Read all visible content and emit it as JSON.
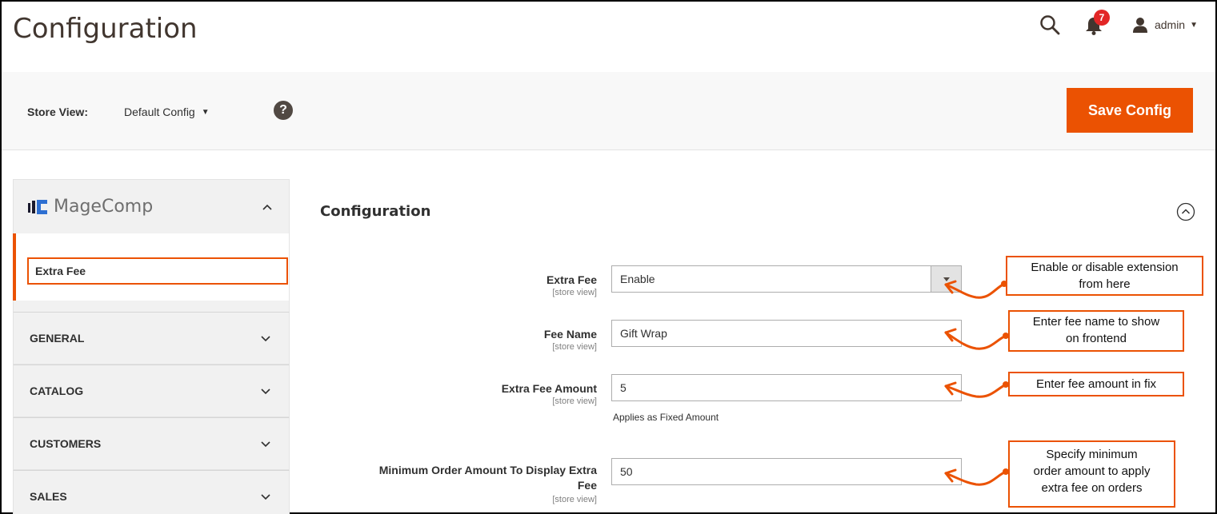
{
  "header": {
    "title": "Configuration",
    "notification_count": "7",
    "user_name": "admin"
  },
  "store_bar": {
    "label": "Store View:",
    "selected": "Default Config",
    "save_label": "Save Config"
  },
  "sidebar": {
    "brand": "MageComp",
    "active_item": "Extra Fee",
    "sections": [
      {
        "label": "GENERAL"
      },
      {
        "label": "CATALOG"
      },
      {
        "label": "CUSTOMERS"
      },
      {
        "label": "SALES"
      }
    ]
  },
  "main": {
    "section_title": "Configuration",
    "fields": [
      {
        "label": "Extra Fee",
        "scope": "[store view]",
        "value": "Enable"
      },
      {
        "label": "Fee Name",
        "scope": "[store view]",
        "value": "Gift Wrap"
      },
      {
        "label": "Extra Fee Amount",
        "scope": "[store view]",
        "value": "5",
        "note": "Applies as Fixed Amount"
      },
      {
        "label_line1": "Minimum Order Amount To Display Extra",
        "label_line2": "Fee",
        "scope": "[store view]",
        "value": "50"
      }
    ]
  },
  "annotations": [
    {
      "line1": "Enable or disable extension",
      "line2": "from here"
    },
    {
      "line1": "Enter fee name to show",
      "line2": "on frontend"
    },
    {
      "line1": "Enter fee amount in fix"
    },
    {
      "line1": "Specify minimum",
      "line2": "order amount to apply",
      "line3": "extra fee on orders"
    }
  ],
  "colors": {
    "accent": "#eb5202",
    "badge": "#e22626",
    "panel": "#f1f1f1"
  }
}
